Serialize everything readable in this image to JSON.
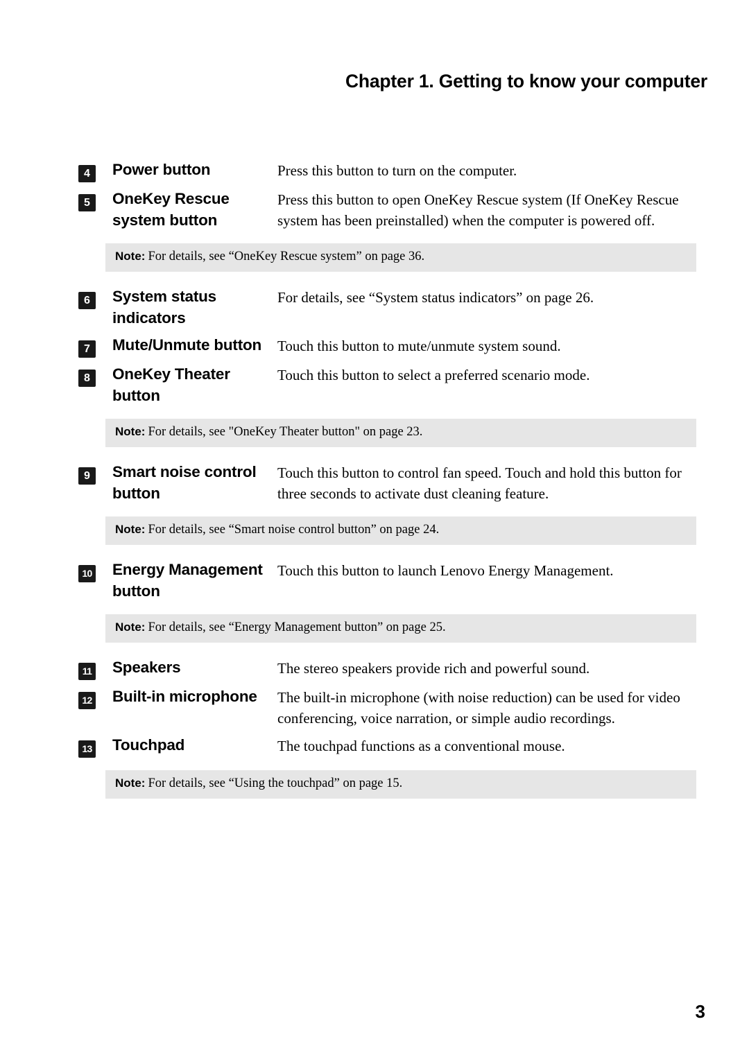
{
  "header": {
    "title": "Chapter 1. Getting to know your computer"
  },
  "page_number": "3",
  "colors": {
    "badge_background": "#1a1a1a",
    "badge_text": "#ffffff",
    "note_band_background": "#e6e6e6",
    "body_text": "#000000"
  },
  "items": [
    {
      "number": "4",
      "label": "Power button",
      "description": "Press this button to turn on the computer."
    },
    {
      "number": "5",
      "label": "OneKey Rescue system button",
      "description": "Press this button to open OneKey Rescue system (If OneKey Rescue system has been preinstalled) when the computer is powered off."
    },
    {
      "number": "6",
      "label": "System status indicators",
      "description": "For details, see “System status indicators” on page 26."
    },
    {
      "number": "7",
      "label": "Mute/Unmute button",
      "description": "Touch this button to mute/unmute system sound."
    },
    {
      "number": "8",
      "label": "OneKey Theater button",
      "description": "Touch this button to select a preferred scenario mode."
    },
    {
      "number": "9",
      "label": "Smart noise control button",
      "description": "Touch this button to control fan speed. Touch and hold this button for three seconds to activate dust cleaning feature."
    },
    {
      "number": "10",
      "label": "Energy Management button",
      "description": "Touch this button to launch Lenovo Energy Management."
    },
    {
      "number": "11",
      "label": "Speakers",
      "description": "The stereo speakers provide rich and powerful sound."
    },
    {
      "number": "12",
      "label": "Built-in microphone",
      "description": "The built-in microphone (with noise reduction) can be used for video conferencing, voice narration, or simple audio recordings."
    },
    {
      "number": "13",
      "label": "Touchpad",
      "description": "The touchpad functions as a conventional mouse."
    }
  ],
  "notes": [
    {
      "label": "Note:",
      "text": "For details, see “OneKey Rescue system” on page 36."
    },
    {
      "label": "Note:",
      "text": "For details, see \"OneKey Theater button\" on page 23."
    },
    {
      "label": "Note:",
      "text": "For details, see “Smart noise control button” on page 24."
    },
    {
      "label": "Note:",
      "text": "For details, see “Energy Management button” on page 25."
    },
    {
      "label": "Note:",
      "text": "For details, see “Using the touchpad” on page 15."
    }
  ]
}
